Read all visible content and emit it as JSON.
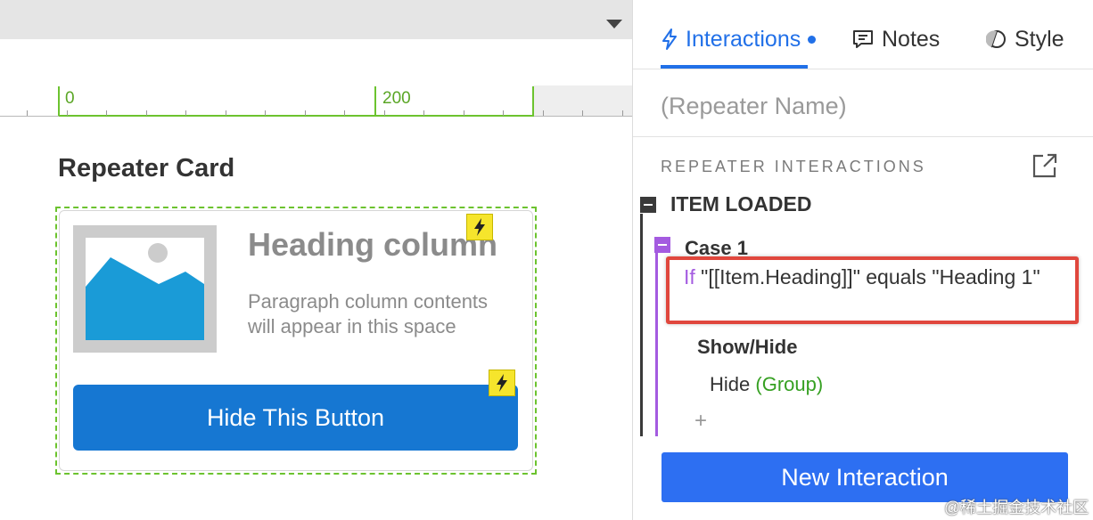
{
  "canvas": {
    "ruler": {
      "labels": [
        "0",
        "200"
      ]
    },
    "card_title": "Repeater Card",
    "card": {
      "heading": "Heading column",
      "paragraph": "Paragraph column contents will appear in this space",
      "image_icon": "image-placeholder-icon",
      "interaction_badge_icon": "lightning-bolt-icon",
      "button_label": "Hide This Button",
      "button_color": "#1677d2"
    }
  },
  "panel": {
    "tabs": [
      {
        "label": "Interactions",
        "icon": "lightning-icon",
        "active": true
      },
      {
        "label": "Notes",
        "icon": "speech-bubble-icon",
        "active": false
      },
      {
        "label": "Style",
        "icon": "style-swatch-icon",
        "active": false
      }
    ],
    "widget_name_placeholder": "(Repeater Name)",
    "section_title": "REPEATER INTERACTIONS",
    "event": {
      "label": "ITEM LOADED",
      "case": {
        "label": "Case 1",
        "condition": {
          "keyword": "If",
          "text": "\"[[Item.Heading]]\" equals \"Heading 1\""
        },
        "action": {
          "label": "Show/Hide",
          "verb": "Hide",
          "target": "(Group)"
        },
        "add_symbol": "+"
      }
    },
    "new_interaction_label": "New Interaction",
    "accent_color": "#2170e8",
    "highlight_color": "#e0473d"
  },
  "watermark": "@稀土掘金技术社区"
}
